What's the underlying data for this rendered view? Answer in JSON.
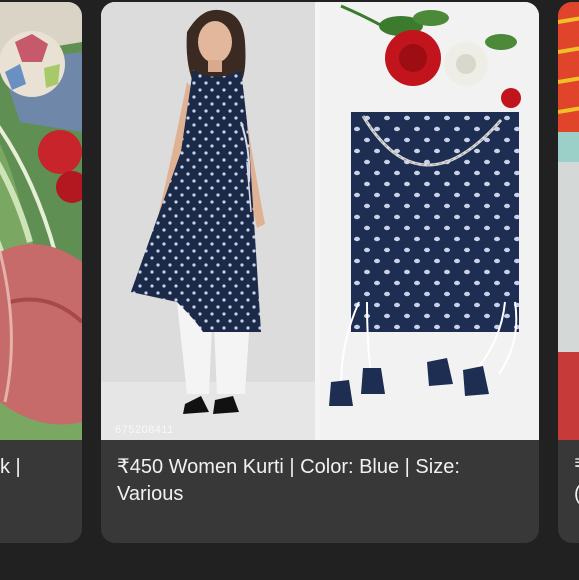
{
  "cards": [
    {
      "caption": "k |",
      "image": "bedding-with-ball-and-scarf"
    },
    {
      "caption": "₹450 Women Kurti | Color: Blue | Size: Various",
      "image": "navy-printed-kurti-model-and-flatlay",
      "watermark": "675208411"
    },
    {
      "caption": "₹",
      "caption_line2": "(",
      "image": "colorful-garment"
    }
  ],
  "colors": {
    "background": "#212121",
    "card": "#383838",
    "caption_text": "#f1f1f1",
    "kurti_navy": "#1c2a4a",
    "palazzo_white": "#f4f4f4"
  }
}
